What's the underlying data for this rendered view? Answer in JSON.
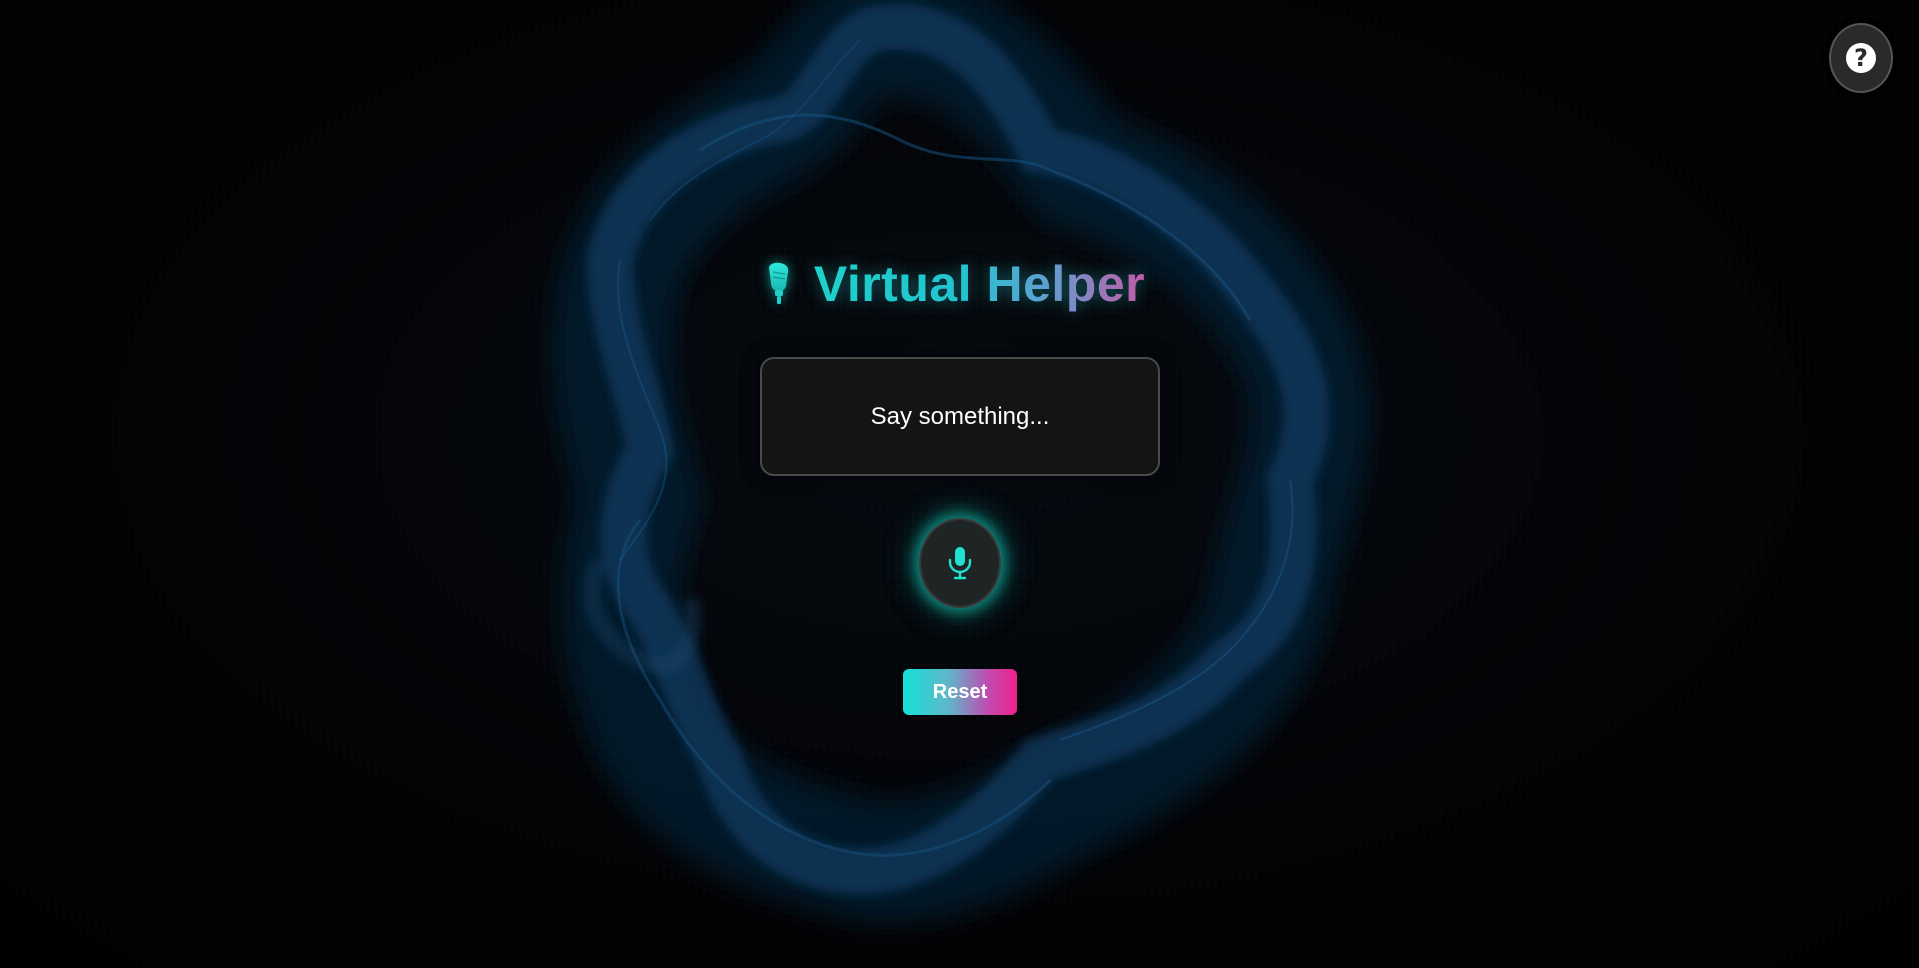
{
  "app": {
    "title": "Virtual Helper"
  },
  "header": {
    "title_icon": "microphone-icon",
    "title": "Virtual Helper"
  },
  "output": {
    "text": "Say something..."
  },
  "mic": {
    "icon": "microphone-icon"
  },
  "controls": {
    "reset_label": "Reset"
  },
  "help": {
    "label": "?",
    "icon": "question-icon"
  },
  "colors": {
    "background": "#000000",
    "accent_cyan": "#1fd1c9",
    "accent_pink": "#f0208c",
    "smoke_blue": "#0d3a5c"
  }
}
